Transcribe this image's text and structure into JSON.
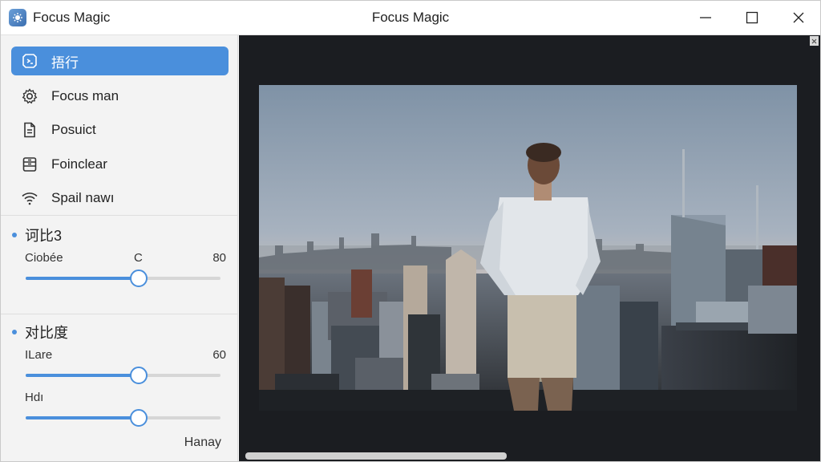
{
  "window": {
    "app_title": "Focus Magic",
    "title": "Focus Magic",
    "app_icon": "focus-magic-app-icon",
    "controls": [
      "minimize-icon",
      "maximize-icon",
      "close-icon"
    ]
  },
  "sidebar": {
    "items": [
      {
        "label": "捂行",
        "icon": "tools-icon",
        "active": true
      },
      {
        "label": "Focus man",
        "icon": "gear-icon",
        "active": false
      },
      {
        "label": "Posuict",
        "icon": "document-icon",
        "active": false
      },
      {
        "label": "Foinclear",
        "icon": "archive-icon",
        "active": false
      },
      {
        "label": "Spail nawı",
        "icon": "wifi-icon",
        "active": false
      }
    ],
    "section1": {
      "title": "诃比3",
      "row_label": "Ciobée",
      "row_mid": "C",
      "row_value": "80",
      "slider_fraction": 0.58
    },
    "section2": {
      "title": "对比度",
      "row1_label": "ILare",
      "row1_value": "60",
      "slider1_fraction": 0.58,
      "row2_label": "Hdı",
      "slider2_fraction": 0.58
    },
    "footer": "Hanay"
  },
  "colors": {
    "accent": "#4a8fdc",
    "canvas_bg": "#1b1d21",
    "sidebar_bg": "#f3f3f3"
  },
  "canvas": {
    "image": "man-on-rooftop-overlooking-city-photo",
    "hscroll_fraction": 0.46
  }
}
